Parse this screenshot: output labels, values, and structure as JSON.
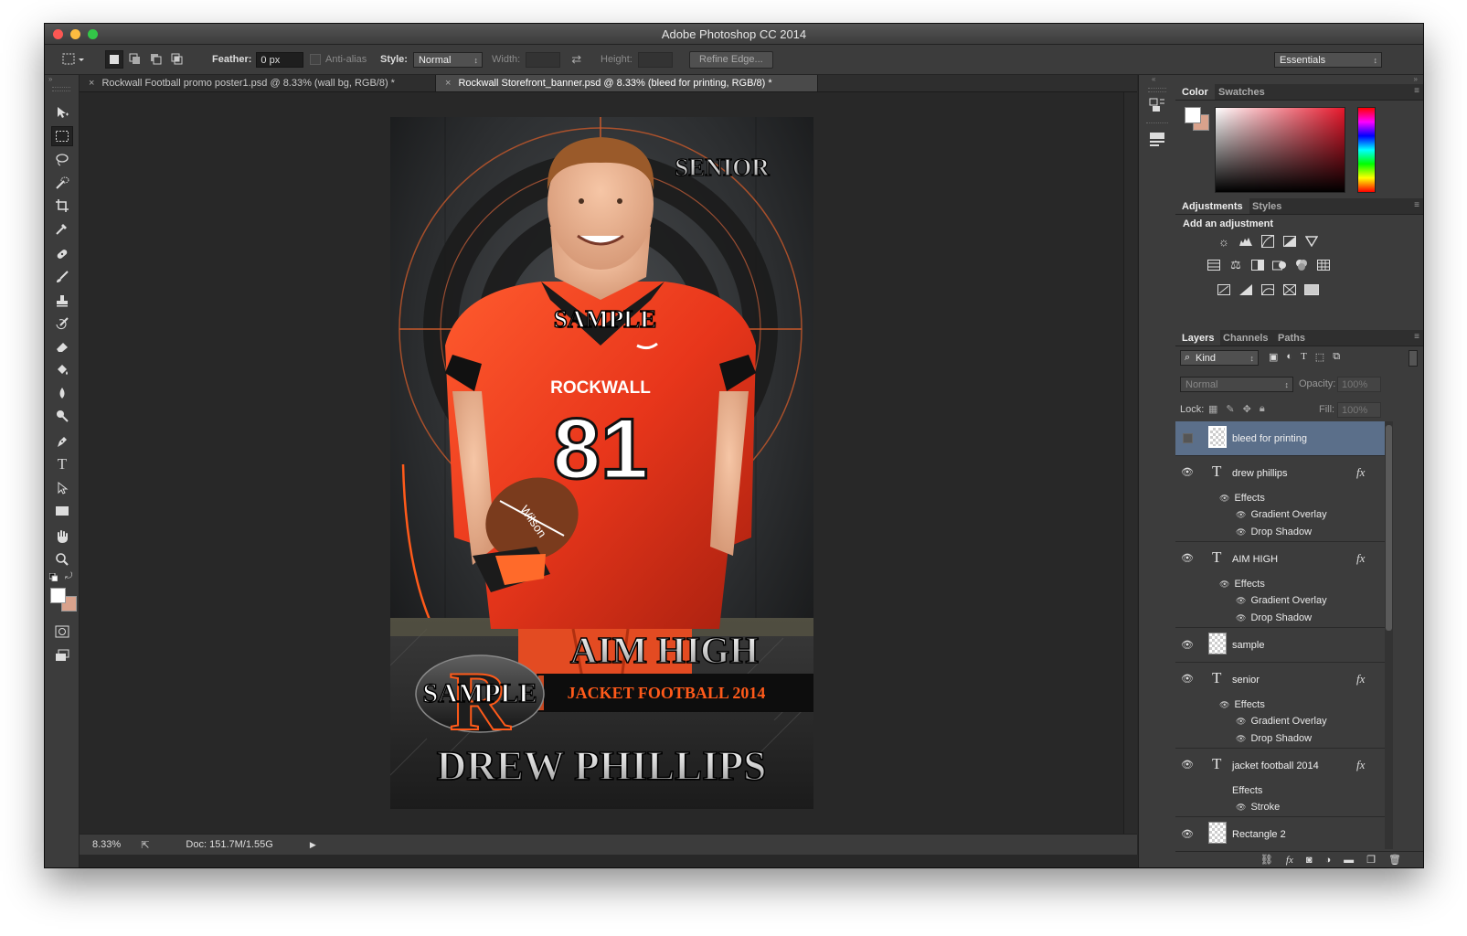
{
  "window": {
    "title": "Adobe Photoshop CC 2014"
  },
  "options": {
    "feather_label": "Feather:",
    "feather_value": "0 px",
    "antialias_label": "Anti-alias",
    "style_label": "Style:",
    "style_value": "Normal",
    "width_label": "Width:",
    "height_label": "Height:",
    "refine_edge": "Refine Edge...",
    "workspace": "Essentials"
  },
  "tabs": [
    {
      "label": "Rockwall Football promo poster1.psd @ 8.33% (wall bg, RGB/8) *"
    },
    {
      "label": "Rockwall Storefront_banner.psd @ 8.33% (bleed for printing, RGB/8) *"
    }
  ],
  "artwork": {
    "senior": "SENIOR",
    "watermark_top": "SAMPLE",
    "jersey_team": "ROCKWALL",
    "jersey_number": "81",
    "aim_high": "AIM HIGH",
    "logo_letter": "R",
    "watermark_bottom": "SAMPLE",
    "banner": "JACKET FOOTBALL 2014",
    "player_name": "DREW PHILLIPS",
    "ball_brand": "Wilson"
  },
  "status": {
    "zoom": "8.33%",
    "doc": "Doc: 151.7M/1.55G"
  },
  "color_panel": {
    "tabs": [
      "Color",
      "Swatches"
    ]
  },
  "adjustments": {
    "tabs": [
      "Adjustments",
      "Styles"
    ],
    "heading": "Add an adjustment"
  },
  "layers_panel": {
    "tabs": [
      "Layers",
      "Channels",
      "Paths"
    ],
    "filter": "Kind",
    "blend_mode": "Normal",
    "opacity_label": "Opacity:",
    "opacity_value": "100%",
    "lock_label": "Lock:",
    "fill_label": "Fill:",
    "fill_value": "100%",
    "effects_label": "Effects",
    "layers": [
      {
        "name": "bleed for printing"
      },
      {
        "name": "drew phillips",
        "effects": [
          "Gradient Overlay",
          "Drop Shadow"
        ]
      },
      {
        "name": "AIM HIGH",
        "effects": [
          "Gradient Overlay",
          "Drop Shadow"
        ]
      },
      {
        "name": "sample"
      },
      {
        "name": "senior",
        "effects": [
          "Gradient Overlay",
          "Drop Shadow"
        ]
      },
      {
        "name": "jacket football 2014",
        "effects": [
          "Stroke"
        ]
      },
      {
        "name": "Rectangle 2"
      }
    ]
  },
  "colors": {
    "accent": "#ff5a1a",
    "jersey": "#e8361b",
    "selected_layer": "#5b6f8a",
    "ui_dark": "#282828",
    "ui_panel": "#3c3c3c"
  }
}
